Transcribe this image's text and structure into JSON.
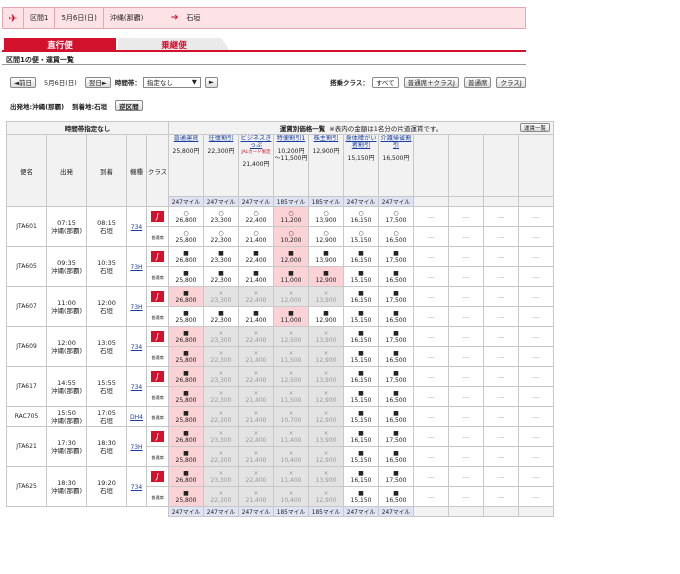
{
  "route": {
    "segment": "区間1",
    "date": "5月6日(日)",
    "from": "沖縄(那覇)",
    "to": "石垣"
  },
  "tabs": {
    "direct": "直行便",
    "connect": "乗継便"
  },
  "section_title": "区間1の便・運賃一覧",
  "controls": {
    "prev_day": "◄前日",
    "date": "5月6日(日)",
    "next_day": "翌日►",
    "time_label": "時間帯：",
    "time_value": "指定なし",
    "next_btn": "►",
    "class_label": "搭乗クラス：",
    "class_all": "すべて",
    "class_normal_j": "普通席＋クラスJ",
    "class_normal": "普通席",
    "class_j": "クラスJ"
  },
  "info": {
    "departure": "出発地:沖縄(那覇)",
    "arrival": "到着地:石垣",
    "swap": "逆区間"
  },
  "table": {
    "time_header": "時間帯指定なし",
    "fare_header": "運賃別価格一覧",
    "fare_note": "※表内の金額は1名分の片道運賃です。",
    "fare_list_btn": "運賃一覧",
    "cols": {
      "flight": "便名",
      "dep": "出発",
      "arr": "到着",
      "aircraft": "機種",
      "class": "クラス"
    },
    "fares": [
      {
        "name": "普通運賃",
        "price": "25,800円",
        "miles": "247マイル"
      },
      {
        "name": "往復割引",
        "price": "22,300円",
        "miles": "247マイル"
      },
      {
        "name": "ビジネスきっぷ",
        "sub": "JALカード限定",
        "price": "21,400円",
        "miles": "247マイル"
      },
      {
        "name": "特便割引1",
        "price": "10,200円 〜11,500円",
        "miles": "185マイル"
      },
      {
        "name": "株主割引",
        "price": "12,900円",
        "miles": "185マイル"
      },
      {
        "name": "身体障がい者割引",
        "price": "15,150円",
        "miles": "247マイル"
      },
      {
        "name": "介護帰省割引",
        "price": "16,500円",
        "miles": "247マイル"
      }
    ],
    "class_j_symbol": "J",
    "class_normal_text": "普通席",
    "dash": "---",
    "flights": [
      {
        "no": "JTA601",
        "dep_time": "07:15",
        "dep_place": "沖縄(那覇)",
        "arr_time": "08:15",
        "arr_place": "石垣",
        "aircraft": "734",
        "rows": [
          [
            {
              "s": "○",
              "v": "26,800",
              "c": "w"
            },
            {
              "s": "○",
              "v": "23,300",
              "c": "w"
            },
            {
              "s": "○",
              "v": "22,400",
              "c": "w"
            },
            {
              "s": "○",
              "v": "11,200",
              "c": "p"
            },
            {
              "s": "○",
              "v": "13,900",
              "c": "w"
            },
            {
              "s": "○",
              "v": "16,150",
              "c": "w"
            },
            {
              "s": "○",
              "v": "17,500",
              "c": "w"
            }
          ],
          [
            {
              "s": "○",
              "v": "25,800",
              "c": "w"
            },
            {
              "s": "○",
              "v": "22,300",
              "c": "w"
            },
            {
              "s": "○",
              "v": "21,400",
              "c": "w"
            },
            {
              "s": "○",
              "v": "10,200",
              "c": "p"
            },
            {
              "s": "○",
              "v": "12,900",
              "c": "w"
            },
            {
              "s": "○",
              "v": "15,150",
              "c": "w"
            },
            {
              "s": "○",
              "v": "16,500",
              "c": "w"
            }
          ]
        ]
      },
      {
        "no": "JTA605",
        "dep_time": "09:35",
        "dep_place": "沖縄(那覇)",
        "arr_time": "10:35",
        "arr_place": "石垣",
        "aircraft": "73H",
        "rows": [
          [
            {
              "s": "■",
              "v": "26,800",
              "c": "w"
            },
            {
              "s": "■",
              "v": "23,300",
              "c": "w"
            },
            {
              "s": "■",
              "v": "22,400",
              "c": "w"
            },
            {
              "s": "■",
              "v": "12,000",
              "c": "p"
            },
            {
              "s": "■",
              "v": "13,900",
              "c": "w"
            },
            {
              "s": "■",
              "v": "16,150",
              "c": "w"
            },
            {
              "s": "■",
              "v": "17,500",
              "c": "w"
            }
          ],
          [
            {
              "s": "■",
              "v": "25,800",
              "c": "w"
            },
            {
              "s": "■",
              "v": "22,300",
              "c": "w"
            },
            {
              "s": "■",
              "v": "21,400",
              "c": "w"
            },
            {
              "s": "■",
              "v": "11,000",
              "c": "p"
            },
            {
              "s": "■",
              "v": "12,900",
              "c": "p"
            },
            {
              "s": "■",
              "v": "15,150",
              "c": "w"
            },
            {
              "s": "■",
              "v": "16,500",
              "c": "w"
            }
          ]
        ]
      },
      {
        "no": "JTA607",
        "dep_time": "11:00",
        "dep_place": "沖縄(那覇)",
        "arr_time": "12:00",
        "arr_place": "石垣",
        "aircraft": "73H",
        "rows": [
          [
            {
              "s": "■",
              "v": "26,800",
              "c": "p"
            },
            {
              "s": "×",
              "v": "23,300",
              "c": "gr"
            },
            {
              "s": "×",
              "v": "22,400",
              "c": "gr"
            },
            {
              "s": "×",
              "v": "12,000",
              "c": "gr"
            },
            {
              "s": "×",
              "v": "13,900",
              "c": "gr"
            },
            {
              "s": "■",
              "v": "16,150",
              "c": "w"
            },
            {
              "s": "■",
              "v": "17,500",
              "c": "w"
            }
          ],
          [
            {
              "s": "■",
              "v": "25,800",
              "c": "w"
            },
            {
              "s": "■",
              "v": "22,300",
              "c": "w"
            },
            {
              "s": "■",
              "v": "21,400",
              "c": "w"
            },
            {
              "s": "■",
              "v": "11,000",
              "c": "p"
            },
            {
              "s": "■",
              "v": "12,900",
              "c": "w"
            },
            {
              "s": "■",
              "v": "15,150",
              "c": "w"
            },
            {
              "s": "■",
              "v": "16,500",
              "c": "w"
            }
          ]
        ]
      },
      {
        "no": "JTA609",
        "dep_time": "12:00",
        "dep_place": "沖縄(那覇)",
        "arr_time": "13:05",
        "arr_place": "石垣",
        "aircraft": "734",
        "rows": [
          [
            {
              "s": "■",
              "v": "26,800",
              "c": "p"
            },
            {
              "s": "×",
              "v": "23,300",
              "c": "gr"
            },
            {
              "s": "×",
              "v": "22,400",
              "c": "gr"
            },
            {
              "s": "×",
              "v": "12,500",
              "c": "gr"
            },
            {
              "s": "×",
              "v": "13,900",
              "c": "gr"
            },
            {
              "s": "■",
              "v": "16,150",
              "c": "w"
            },
            {
              "s": "■",
              "v": "17,500",
              "c": "w"
            }
          ],
          [
            {
              "s": "■",
              "v": "25,800",
              "c": "p"
            },
            {
              "s": "×",
              "v": "22,300",
              "c": "gr"
            },
            {
              "s": "×",
              "v": "21,400",
              "c": "gr"
            },
            {
              "s": "×",
              "v": "11,500",
              "c": "gr"
            },
            {
              "s": "×",
              "v": "12,900",
              "c": "gr"
            },
            {
              "s": "■",
              "v": "15,150",
              "c": "w"
            },
            {
              "s": "■",
              "v": "16,500",
              "c": "w"
            }
          ]
        ]
      },
      {
        "no": "JTA617",
        "dep_time": "14:55",
        "dep_place": "沖縄(那覇)",
        "arr_time": "15:55",
        "arr_place": "石垣",
        "aircraft": "734",
        "rows": [
          [
            {
              "s": "■",
              "v": "26,800",
              "c": "p"
            },
            {
              "s": "×",
              "v": "23,300",
              "c": "gr"
            },
            {
              "s": "×",
              "v": "22,400",
              "c": "gr"
            },
            {
              "s": "×",
              "v": "12,500",
              "c": "gr"
            },
            {
              "s": "×",
              "v": "13,900",
              "c": "gr"
            },
            {
              "s": "■",
              "v": "16,150",
              "c": "w"
            },
            {
              "s": "■",
              "v": "17,500",
              "c": "w"
            }
          ],
          [
            {
              "s": "■",
              "v": "25,800",
              "c": "p"
            },
            {
              "s": "×",
              "v": "22,300",
              "c": "gr"
            },
            {
              "s": "×",
              "v": "21,400",
              "c": "gr"
            },
            {
              "s": "×",
              "v": "11,500",
              "c": "gr"
            },
            {
              "s": "×",
              "v": "12,900",
              "c": "gr"
            },
            {
              "s": "■",
              "v": "15,150",
              "c": "w"
            },
            {
              "s": "■",
              "v": "16,500",
              "c": "w"
            }
          ]
        ]
      },
      {
        "no": "RAC705",
        "dep_time": "15:50",
        "dep_place": "沖縄(那覇)",
        "arr_time": "17:05",
        "arr_place": "石垣",
        "aircraft": "DH4",
        "rows": [
          [
            {
              "s": "■",
              "v": "25,800",
              "c": "p"
            },
            {
              "s": "×",
              "v": "22,300",
              "c": "gr"
            },
            {
              "s": "×",
              "v": "21,400",
              "c": "gr"
            },
            {
              "s": "×",
              "v": "10,700",
              "c": "gr"
            },
            {
              "s": "×",
              "v": "12,900",
              "c": "gr"
            },
            {
              "s": "■",
              "v": "15,150",
              "c": "w"
            },
            {
              "s": "■",
              "v": "16,500",
              "c": "w"
            }
          ]
        ]
      },
      {
        "no": "JTA621",
        "dep_time": "17:30",
        "dep_place": "沖縄(那覇)",
        "arr_time": "18:30",
        "arr_place": "石垣",
        "aircraft": "73H",
        "rows": [
          [
            {
              "s": "■",
              "v": "26,800",
              "c": "p"
            },
            {
              "s": "×",
              "v": "23,300",
              "c": "gr"
            },
            {
              "s": "×",
              "v": "22,400",
              "c": "gr"
            },
            {
              "s": "×",
              "v": "11,400",
              "c": "gr"
            },
            {
              "s": "×",
              "v": "13,900",
              "c": "gr"
            },
            {
              "s": "■",
              "v": "16,150",
              "c": "w"
            },
            {
              "s": "■",
              "v": "17,500",
              "c": "w"
            }
          ],
          [
            {
              "s": "■",
              "v": "25,800",
              "c": "p"
            },
            {
              "s": "×",
              "v": "22,300",
              "c": "gr"
            },
            {
              "s": "×",
              "v": "21,400",
              "c": "gr"
            },
            {
              "s": "×",
              "v": "10,400",
              "c": "gr"
            },
            {
              "s": "×",
              "v": "12,900",
              "c": "gr"
            },
            {
              "s": "■",
              "v": "15,150",
              "c": "w"
            },
            {
              "s": "■",
              "v": "16,500",
              "c": "w"
            }
          ]
        ]
      },
      {
        "no": "JTA625",
        "dep_time": "18:30",
        "dep_place": "沖縄(那覇)",
        "arr_time": "19:20",
        "arr_place": "石垣",
        "aircraft": "734",
        "rows": [
          [
            {
              "s": "■",
              "v": "26,800",
              "c": "p"
            },
            {
              "s": "×",
              "v": "23,300",
              "c": "gr"
            },
            {
              "s": "×",
              "v": "22,400",
              "c": "gr"
            },
            {
              "s": "×",
              "v": "11,400",
              "c": "gr"
            },
            {
              "s": "×",
              "v": "13,900",
              "c": "gr"
            },
            {
              "s": "■",
              "v": "16,150",
              "c": "w"
            },
            {
              "s": "■",
              "v": "17,500",
              "c": "w"
            }
          ],
          [
            {
              "s": "■",
              "v": "25,800",
              "c": "p"
            },
            {
              "s": "×",
              "v": "22,300",
              "c": "gr"
            },
            {
              "s": "×",
              "v": "21,400",
              "c": "gr"
            },
            {
              "s": "×",
              "v": "10,400",
              "c": "gr"
            },
            {
              "s": "×",
              "v": "12,900",
              "c": "gr"
            },
            {
              "s": "■",
              "v": "15,150",
              "c": "w"
            },
            {
              "s": "■",
              "v": "16,500",
              "c": "w"
            }
          ]
        ]
      }
    ]
  }
}
